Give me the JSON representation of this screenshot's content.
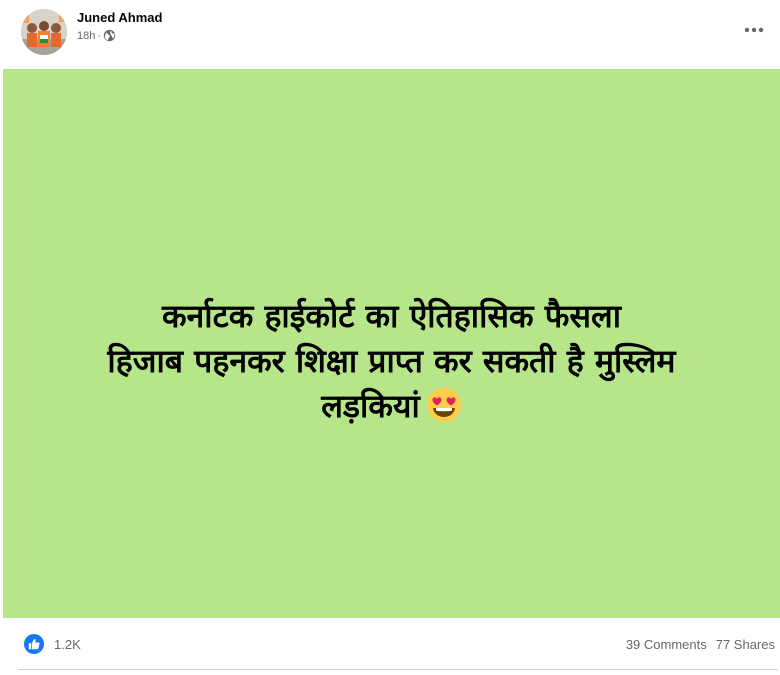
{
  "post": {
    "author": "Juned Ahmad",
    "timestamp": "18h",
    "audience_icon": "globe-icon",
    "more_icon": "more-options-icon",
    "background_color": "#b7e68a",
    "text_lines": [
      "कर्नाटक हाईकोर्ट का ऐतिहासिक फैसला",
      "हिजाब पहनकर शिक्षा प्राप्त कर सकती है मुस्लिम",
      "लड़कियां"
    ],
    "emoji": "heart-eyes-emoji"
  },
  "footer": {
    "reaction_icon": "like-icon",
    "reaction_count": "1.2K",
    "comments": "39 Comments",
    "shares": "77 Shares"
  },
  "colors": {
    "like_blue": "#1877f2",
    "secondary_text": "#65676b"
  }
}
